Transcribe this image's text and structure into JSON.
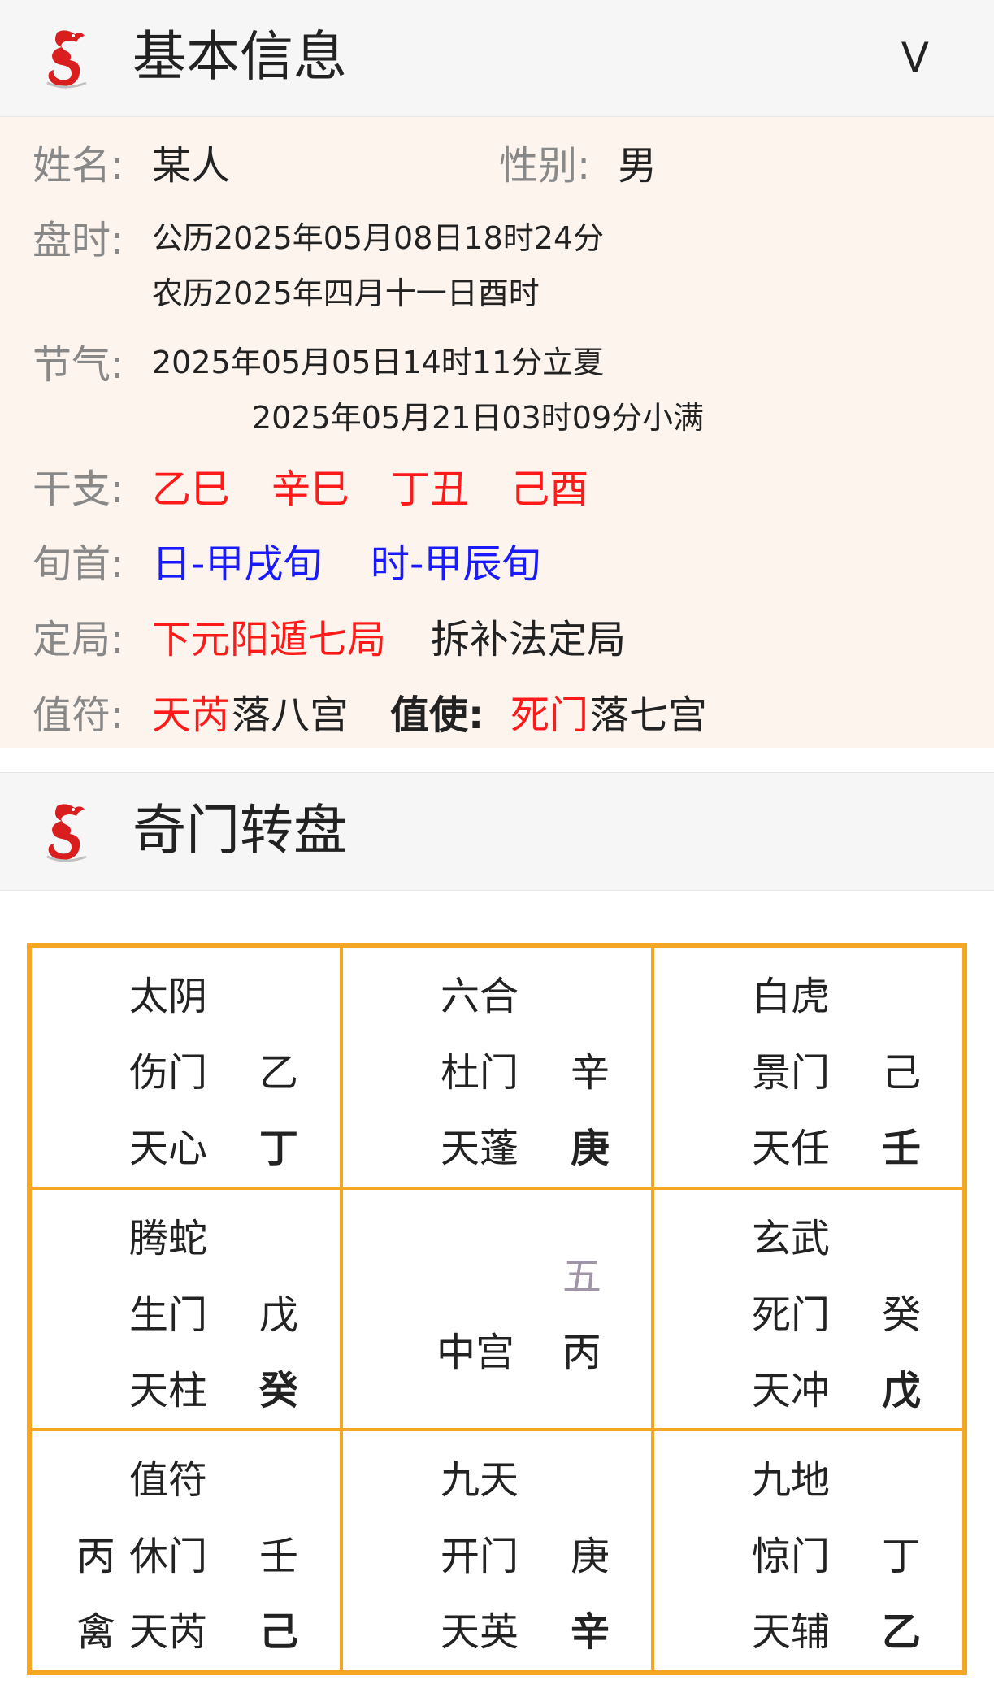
{
  "basic_section": {
    "title": "基本信息",
    "toggle": "V"
  },
  "info": {
    "name_label": "姓名:",
    "name_value": "某人",
    "gender_label": "性别:",
    "gender_value": "男",
    "time_label": "盘时:",
    "time_solar": "公历2025年05月08日18时24分",
    "time_lunar": "农历2025年四月十一日酉时",
    "solar_term_label": "节气:",
    "solar_term_1": "2025年05月05日14时11分立夏",
    "solar_term_2": "2025年05月21日03时09分小满",
    "ganzhi_label": "干支:",
    "ganzhi": [
      "乙巳",
      "辛巳",
      "丁丑",
      "己酉"
    ],
    "xunshou_label": "旬首:",
    "xunshou_day": "日-甲戌旬",
    "xunshou_hour": "时-甲辰旬",
    "ju_label": "定局:",
    "ju_value": "下元阳遁七局",
    "ju_method": "拆补法定局",
    "zhifu_label": "值符:",
    "zhifu_star": "天芮",
    "zhifu_palace": "落八宫",
    "zhishi_label": "值使:",
    "zhishi_door": "死门",
    "zhishi_palace": "落七宫"
  },
  "qimen_section": {
    "title": "奇门转盘"
  },
  "palaces": [
    {
      "god": "太阴",
      "door": "伤门",
      "star": "天心",
      "heaven": "乙",
      "earth": "丁"
    },
    {
      "god": "六合",
      "door": "杜门",
      "star": "天蓬",
      "heaven": "辛",
      "earth": "庚"
    },
    {
      "god": "白虎",
      "door": "景门",
      "star": "天任",
      "heaven": "己",
      "earth": "壬"
    },
    {
      "god": "腾蛇",
      "door": "生门",
      "star": "天柱",
      "heaven": "戊",
      "earth": "癸"
    },
    {
      "center_number": "五",
      "center_name": "中宫",
      "center_stem": "丙"
    },
    {
      "god": "玄武",
      "door": "死门",
      "star": "天冲",
      "heaven": "癸",
      "earth": "戊"
    },
    {
      "god": "值符",
      "door": "休门",
      "star": "天芮",
      "heaven": "壬",
      "earth": "己",
      "extra_top": "丙",
      "extra_bottom": "禽"
    },
    {
      "god": "九天",
      "door": "开门",
      "star": "天英",
      "heaven": "庚",
      "earth": "辛"
    },
    {
      "god": "九地",
      "door": "惊门",
      "star": "天辅",
      "heaven": "丁",
      "earth": "乙"
    }
  ],
  "colors": {
    "accent_red": "#ff1a1a",
    "accent_blue": "#1a1aff",
    "grid_border": "#f5a623",
    "panel_bg": "#fdf4ee"
  }
}
